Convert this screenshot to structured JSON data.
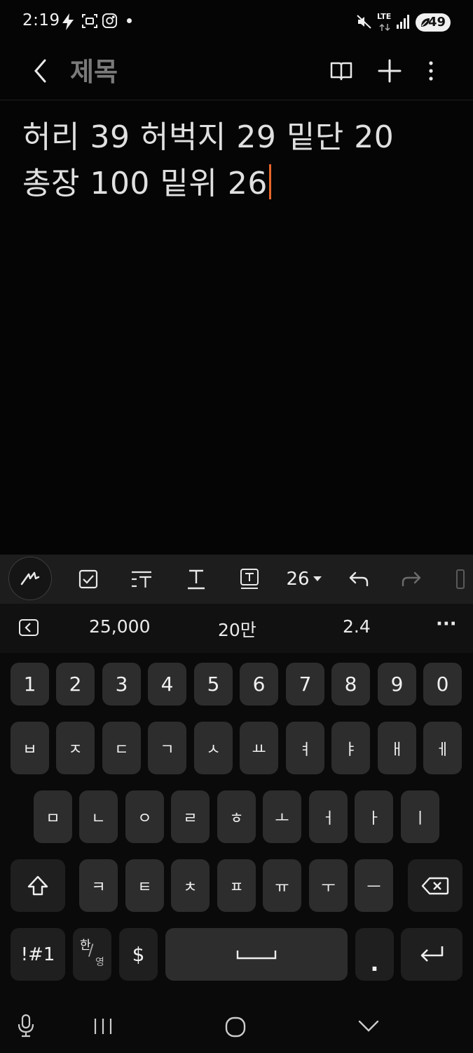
{
  "status_bar": {
    "time": "2:19",
    "network": "LTE",
    "battery": "49"
  },
  "header": {
    "title": "제목"
  },
  "note": {
    "line1": "허리 39 허벅지 29 밑단 20",
    "line2": "총장 100 밑위 26"
  },
  "format_toolbar": {
    "font_size": "26"
  },
  "suggestions": {
    "items": [
      "25,000",
      "20만",
      "2.4"
    ],
    "more": "···"
  },
  "keyboard": {
    "row1": [
      "1",
      "2",
      "3",
      "4",
      "5",
      "6",
      "7",
      "8",
      "9",
      "0"
    ],
    "row2": [
      "ㅂ",
      "ㅈ",
      "ㄷ",
      "ㄱ",
      "ㅅ",
      "ㅛ",
      "ㅕ",
      "ㅑ",
      "ㅐ",
      "ㅔ"
    ],
    "row3": [
      "ㅁ",
      "ㄴ",
      "ㅇ",
      "ㄹ",
      "ㅎ",
      "ㅗ",
      "ㅓ",
      "ㅏ",
      "ㅣ"
    ],
    "row4": [
      "ㅋ",
      "ㅌ",
      "ㅊ",
      "ㅍ",
      "ㅠ",
      "ㅜ",
      "ㅡ"
    ],
    "symbols_label": "!#1",
    "lang_top": "한",
    "lang_bottom": "영",
    "currency": "$",
    "period": "."
  }
}
